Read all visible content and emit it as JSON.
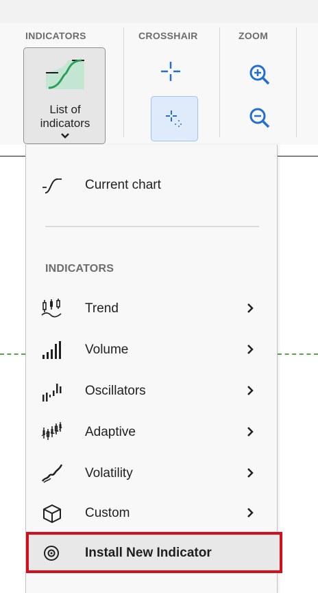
{
  "ribbon": {
    "groups": {
      "indicators": "INDICATORS",
      "crosshair": "CROSSHAIR",
      "zoom": "ZOOM"
    },
    "list_of_indicators_label": "List of\nindicators"
  },
  "menu": {
    "current_chart": "Current chart",
    "section_title": "INDICATORS",
    "items": [
      {
        "label": "Trend",
        "icon": "trend-icon"
      },
      {
        "label": "Volume",
        "icon": "volume-icon"
      },
      {
        "label": "Oscillators",
        "icon": "oscillators-icon"
      },
      {
        "label": "Adaptive",
        "icon": "adaptive-icon"
      },
      {
        "label": "Volatility",
        "icon": "volatility-icon"
      },
      {
        "label": "Custom",
        "icon": "cube-icon"
      }
    ],
    "install_label": "Install New Indicator"
  },
  "colors": {
    "accent_blue": "#1f6fd1",
    "highlight_red": "#d40f1c",
    "indicator_green": "#5aa34a"
  }
}
